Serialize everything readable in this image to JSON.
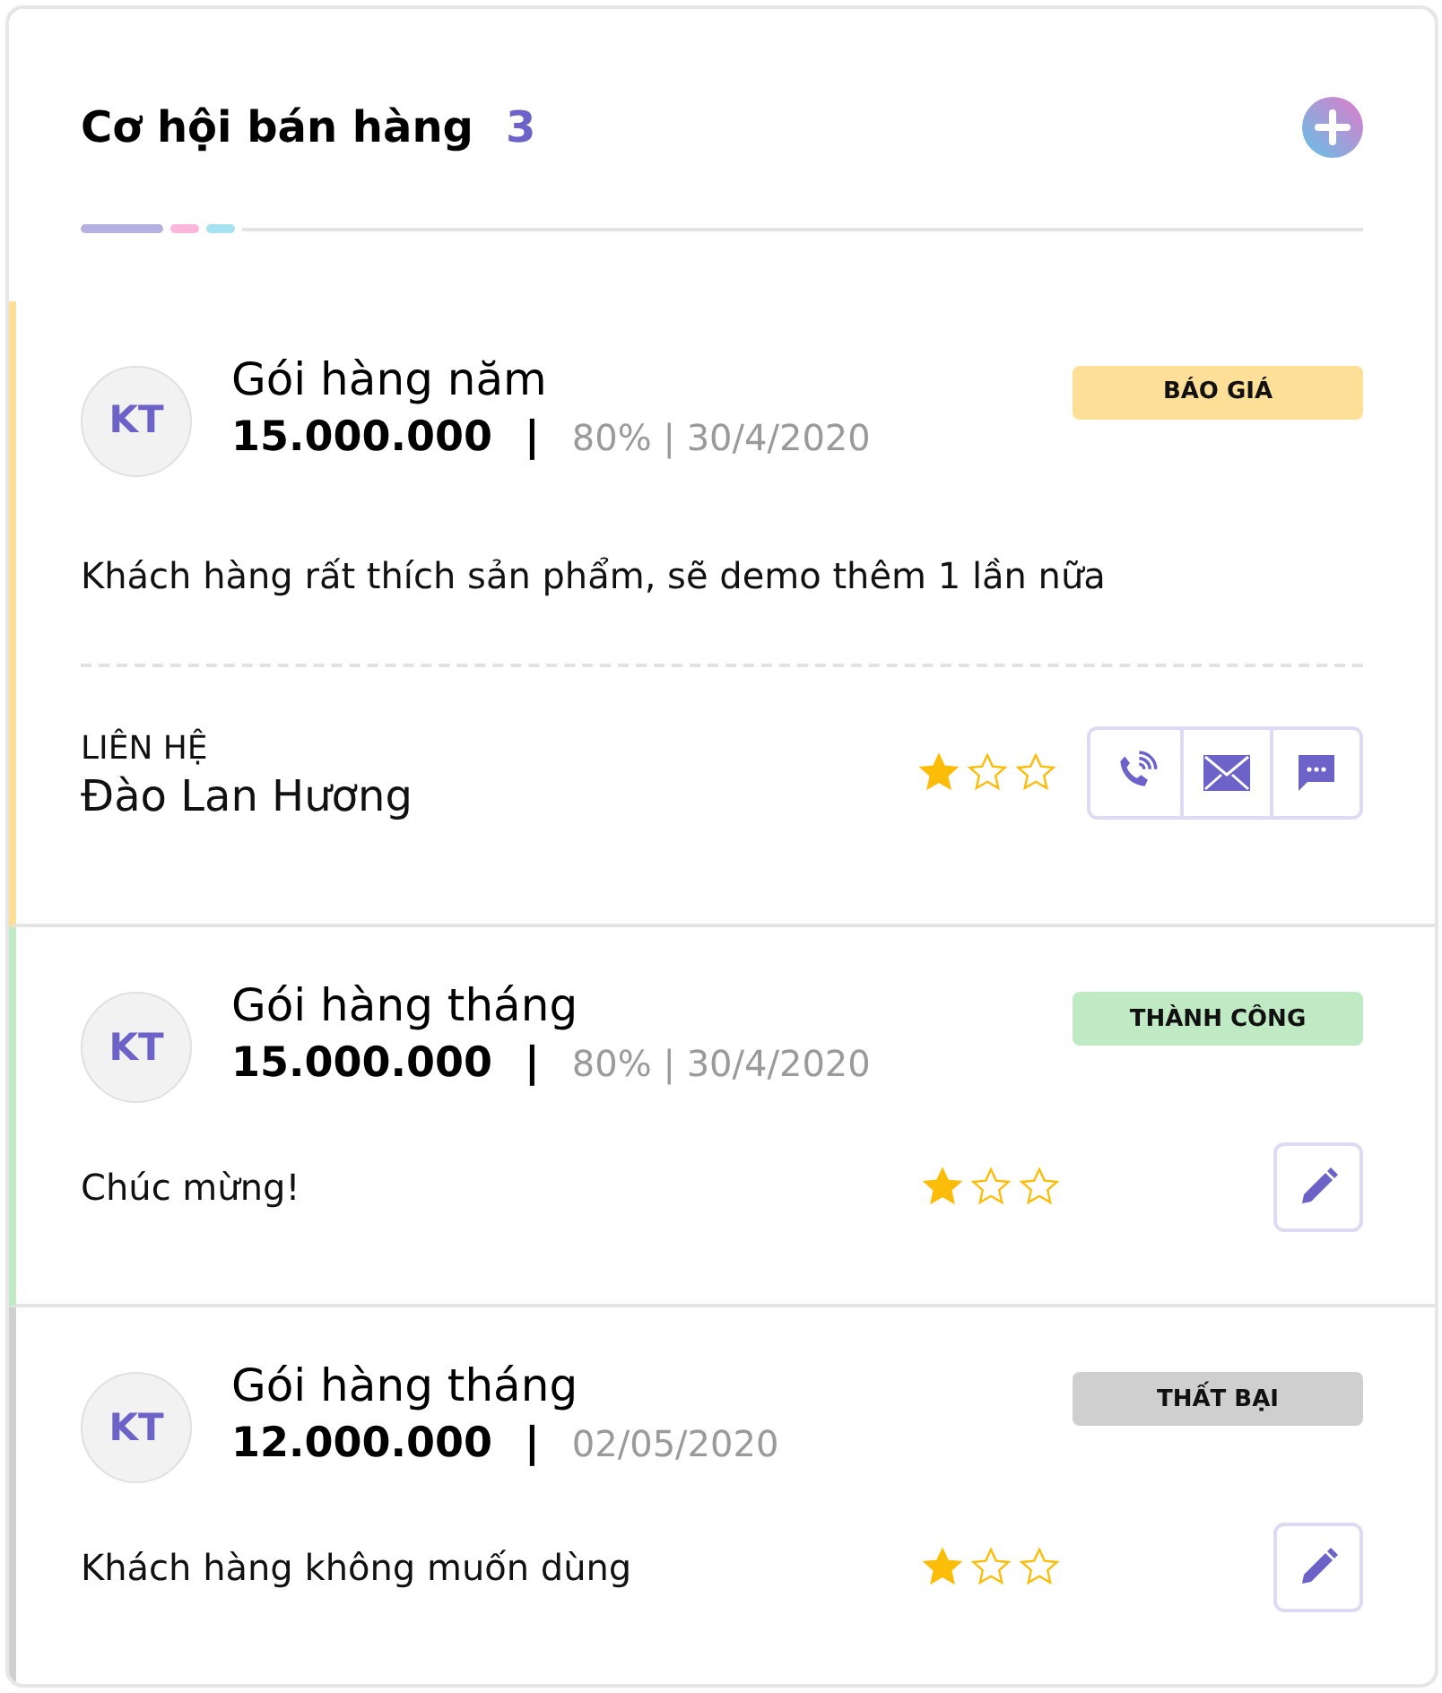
{
  "header": {
    "title": "Cơ hội bán hàng",
    "count": "3"
  },
  "deals": [
    {
      "kind": "contact",
      "color": "#fddf97",
      "avatar": "KT",
      "title": "Gói hàng năm",
      "amount": "15.000.000",
      "separator": "|",
      "meta": "80% | 30/4/2020",
      "status": "BÁO GIÁ",
      "note": "Khách hàng rất thích sản phẩm, sẽ demo thêm 1 lần nữa",
      "contact_label": "LIÊN HỆ",
      "contact_name": "Đào Lan Hương",
      "stars": 1
    },
    {
      "kind": "simple",
      "color": "#bfeac4",
      "avatar": "KT",
      "title": "Gói hàng tháng",
      "amount": "15.000.000",
      "separator": "|",
      "meta": "80% | 30/4/2020",
      "status": "THÀNH CÔNG",
      "note": "Chúc mừng!",
      "stars": 1
    },
    {
      "kind": "simple",
      "color": "#cfcfcf",
      "avatar": "KT",
      "title": "Gói hàng tháng",
      "amount": "12.000.000",
      "separator": "|",
      "meta": "02/05/2020",
      "status": "THẤT BẠI",
      "note": "Khách hàng không muốn dùng",
      "stars": 1
    }
  ]
}
